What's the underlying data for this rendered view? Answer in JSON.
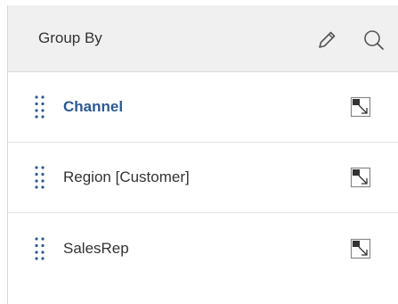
{
  "header": {
    "title": "Group By",
    "edit_icon": "pencil-icon",
    "search_icon": "search-icon"
  },
  "items": [
    {
      "label": "Channel",
      "active": true,
      "grip_icon": "drag-handle-icon",
      "action_icon": "expand-icon"
    },
    {
      "label": "Region [Customer]",
      "active": false,
      "grip_icon": "drag-handle-icon",
      "action_icon": "expand-icon"
    },
    {
      "label": "SalesRep",
      "active": false,
      "grip_icon": "drag-handle-icon",
      "action_icon": "expand-icon"
    }
  ],
  "colors": {
    "header_bg": "#f0f0f0",
    "active_text": "#2d5a8e",
    "grip_dots": "#2d5a8e",
    "text": "#333333"
  }
}
